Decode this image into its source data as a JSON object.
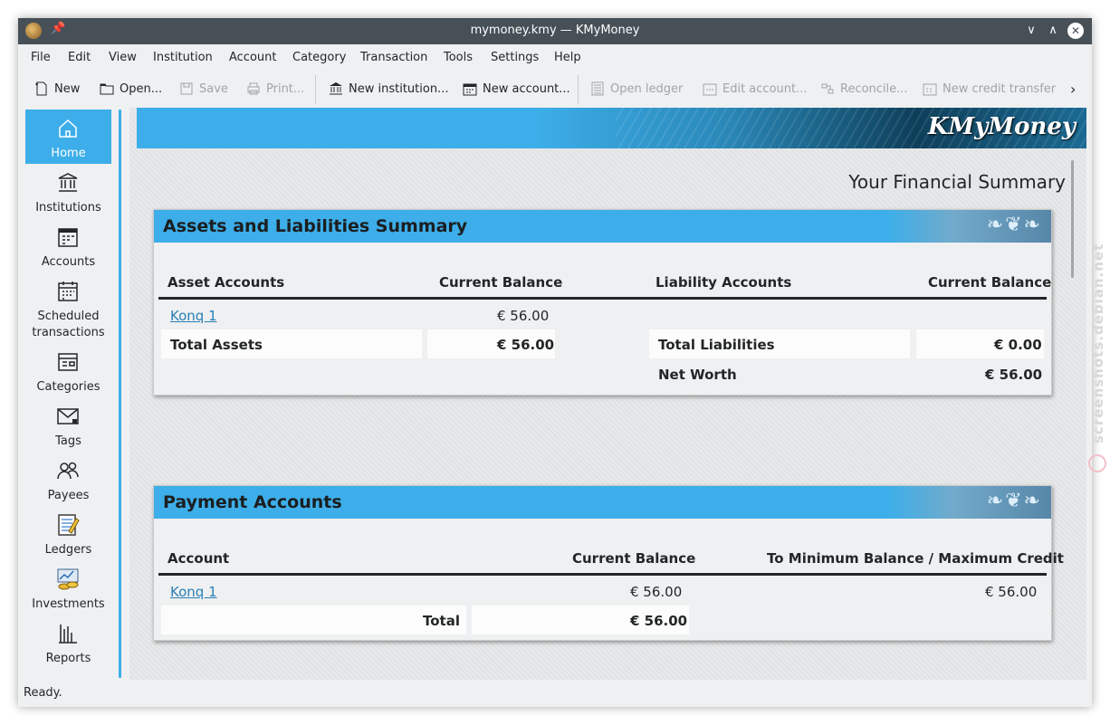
{
  "window": {
    "title": "mymoney.kmy — KMyMoney"
  },
  "menu": [
    "File",
    "Edit",
    "View",
    "Institution",
    "Account",
    "Category",
    "Transaction",
    "Tools",
    "Settings",
    "Help"
  ],
  "toolbar": {
    "new": "New",
    "open": "Open...",
    "save": "Save",
    "print": "Print...",
    "new_institution": "New institution...",
    "new_account": "New account...",
    "open_ledger": "Open ledger",
    "edit_account": "Edit account...",
    "reconcile": "Reconcile...",
    "new_credit_transfer": "New credit transfer"
  },
  "sidebar": {
    "items": [
      {
        "label": "Home",
        "icon": "home-icon",
        "active": true
      },
      {
        "label": "Institutions",
        "icon": "institution-icon"
      },
      {
        "label": "Accounts",
        "icon": "accounts-icon"
      },
      {
        "label": "Scheduled\ntransactions",
        "icon": "calendar-icon"
      },
      {
        "label": "Categories",
        "icon": "categories-icon"
      },
      {
        "label": "Tags",
        "icon": "tag-icon"
      },
      {
        "label": "Payees",
        "icon": "payees-icon"
      },
      {
        "label": "Ledgers",
        "icon": "ledger-icon"
      },
      {
        "label": "Investments",
        "icon": "investments-icon"
      },
      {
        "label": "Reports",
        "icon": "reports-icon"
      }
    ]
  },
  "home": {
    "banner_logo": "KMyMoney",
    "page_title": "Your Financial Summary",
    "assets_panel": {
      "title": "Assets and Liabilities Summary",
      "col_asset_accounts": "Asset Accounts",
      "col_current_balance": "Current Balance",
      "col_liability_accounts": "Liability Accounts",
      "col_current_balance_2": "Current Balance",
      "asset_rows": [
        {
          "name": "Konq 1",
          "balance": "€ 56.00"
        }
      ],
      "total_assets_label": "Total Assets",
      "total_assets_value": "€ 56.00",
      "total_liabilities_label": "Total Liabilities",
      "total_liabilities_value": "€ 0.00",
      "net_worth_label": "Net Worth",
      "net_worth_value": "€ 56.00"
    },
    "payment_panel": {
      "title": "Payment Accounts",
      "col_account": "Account",
      "col_current_balance": "Current Balance",
      "col_min_balance": "To Minimum Balance / Maximum Credit",
      "rows": [
        {
          "name": "Konq 1",
          "balance": "€ 56.00",
          "to_min": "€ 56.00"
        }
      ],
      "total_label": "Total",
      "total_value": "€ 56.00"
    }
  },
  "status": {
    "text": "Ready."
  },
  "watermark": {
    "text": "screenshots.debian.net"
  },
  "colors": {
    "accent": "#3daee9",
    "titlebar": "#475057",
    "link": "#2980b9"
  }
}
